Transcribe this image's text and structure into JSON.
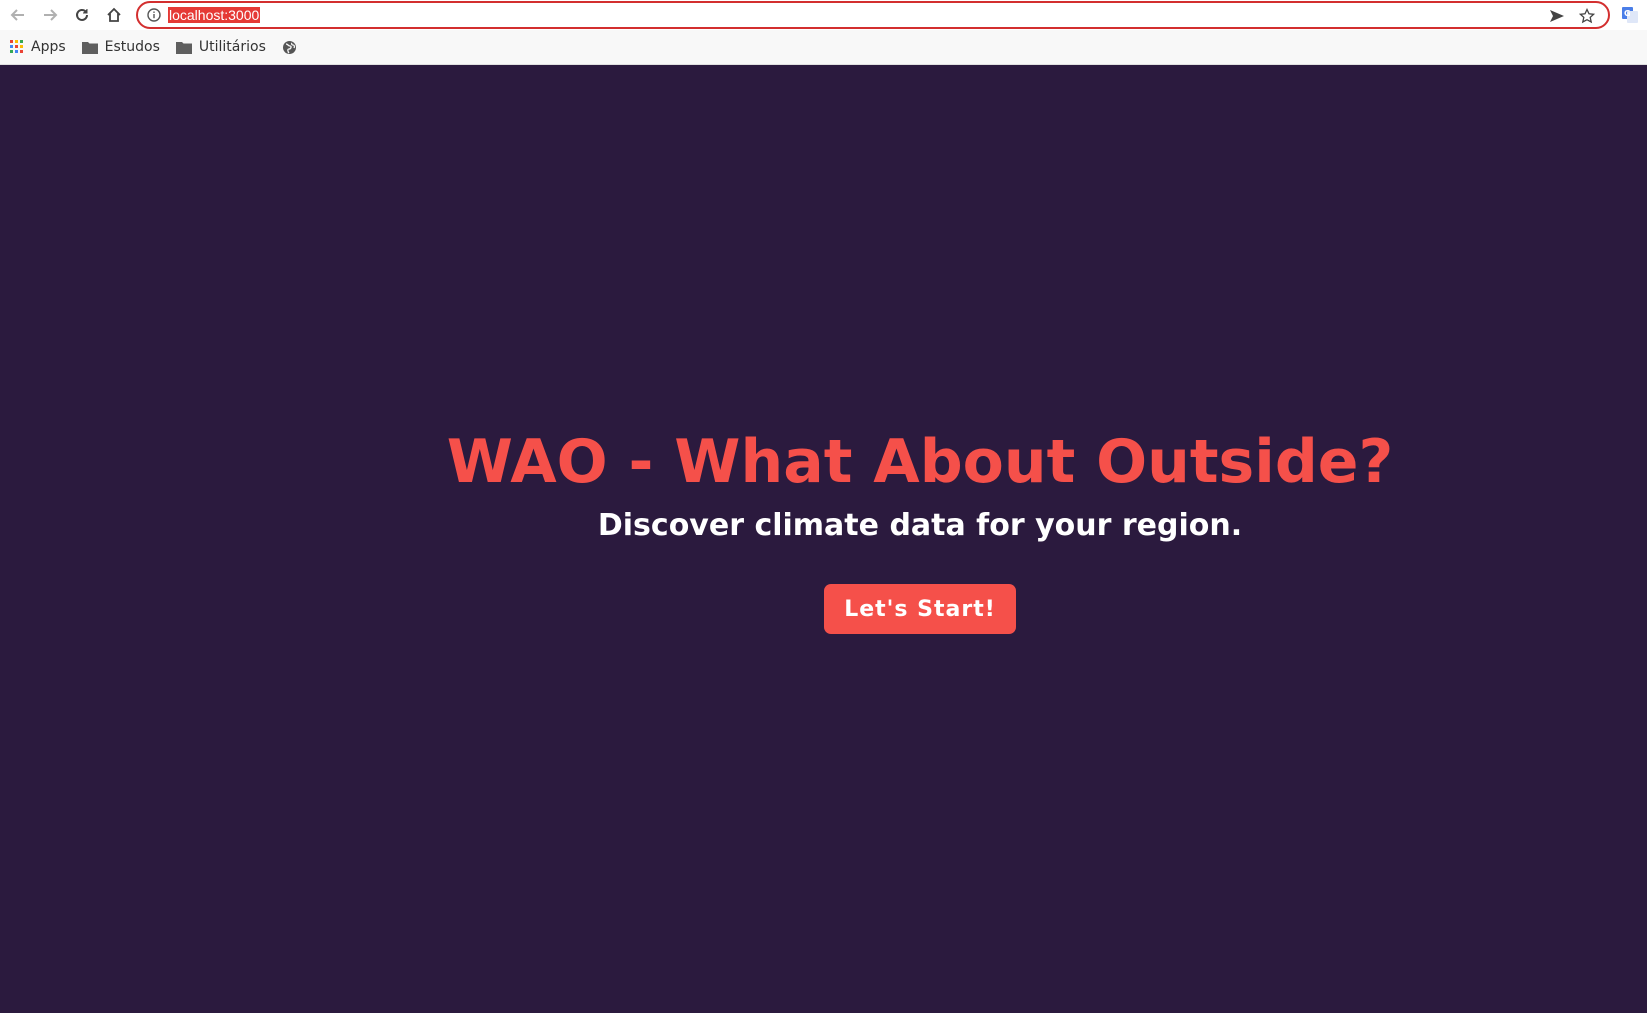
{
  "browser": {
    "url": "localhost:3000",
    "bookmarks": [
      {
        "label": "Apps",
        "icon": "apps-grid-icon"
      },
      {
        "label": "Estudos",
        "icon": "folder-icon"
      },
      {
        "label": "Utilitários",
        "icon": "folder-icon"
      },
      {
        "label": "",
        "icon": "globe-icon"
      }
    ]
  },
  "colors": {
    "page_background": "#2b1a3e",
    "accent": "#f5504a",
    "subtitle": "#ffffff"
  },
  "hero": {
    "title": "WAO - What About Outside?",
    "subtitle": "Discover climate data for your region.",
    "button_label": "Let's Start!"
  }
}
